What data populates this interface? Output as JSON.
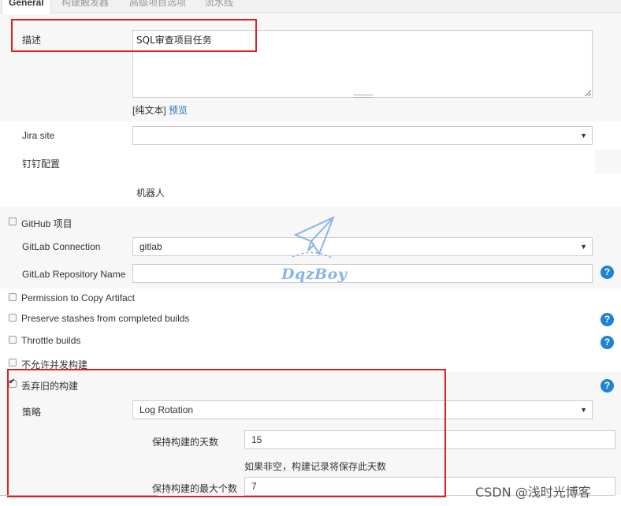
{
  "tabs": [
    {
      "label": "General",
      "active": true
    },
    {
      "label": "构建触发器",
      "active": false
    },
    {
      "label": "高级项目选项",
      "active": false
    },
    {
      "label": "流水线",
      "active": false
    }
  ],
  "description": {
    "label": "描述",
    "value": "SQL审查项目任务",
    "plain_text": "[纯文本]",
    "preview": "预览"
  },
  "jira": {
    "label": "Jira site",
    "value": ""
  },
  "dingtalk": {
    "label": "钉钉配置",
    "robot": "机器人"
  },
  "github": {
    "label": "GitHub 项目",
    "checked": false
  },
  "gitlab_connection": {
    "label": "GitLab Connection",
    "value": "gitlab"
  },
  "gitlab_repo": {
    "label": "GitLab Repository Name",
    "value": ""
  },
  "options": [
    {
      "label": "Permission to Copy Artifact",
      "checked": false
    },
    {
      "label": "Preserve stashes from completed builds",
      "checked": false
    },
    {
      "label": "Throttle builds",
      "checked": false
    },
    {
      "label": "不允许并发构建",
      "checked": false
    },
    {
      "label": "丢弃旧的构建",
      "checked": true
    }
  ],
  "strategy": {
    "label": "策略",
    "value": "Log Rotation",
    "days_label": "保持构建的天数",
    "days_value": "15",
    "days_hint": "如果非空，构建记录将保存此天数",
    "max_label": "保持构建的最大个数",
    "max_value": "7"
  },
  "help_icon": "?",
  "watermark": {
    "text": "DqzBoy",
    "csdn": "CSDN @浅时光博客"
  },
  "colors": {
    "accent": "#1e82d6",
    "highlight": "#e02020"
  }
}
